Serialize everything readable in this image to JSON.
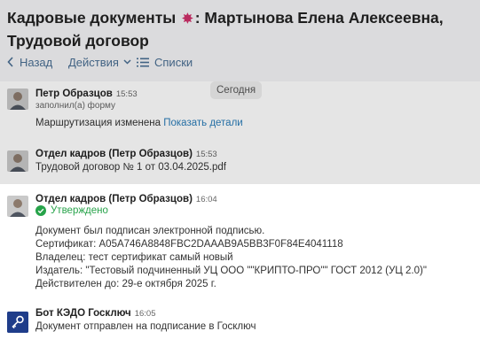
{
  "header": {
    "title_part1": "Кадровые документы",
    "title_part2": ": Мартынова Елена Алексеевна, Трудовой договор"
  },
  "toolbar": {
    "back_label": "Назад",
    "actions_label": "Действия",
    "lists_label": "Списки"
  },
  "feed": {
    "date_badge": "Сегодня",
    "messages": [
      {
        "sender": "Петр Образцов",
        "time": "15:53",
        "subline": "заполнил(а) форму",
        "text": "Маршрутизация изменена",
        "link": "Показать детали"
      },
      {
        "sender": "Отдел кадров (Петр Образцов)",
        "time": "15:53",
        "text": "Трудовой договор № 1 от 03.04.2025.pdf"
      },
      {
        "sender": "Отдел кадров (Петр Образцов)",
        "time": "16:04",
        "status": "Утверждено",
        "lines": [
          "Документ был подписан электронной подписью.",
          "Сертификат: A05A746A8848FBC2DAAAB9A5BB3F0F84E4041118",
          "Владелец: тест сертификат самый новый",
          "Издатель: \"Тестовый подчиненный УЦ ООО \"\"КРИПТО-ПРО\"\" ГОСТ 2012 (УЦ 2.0)\"",
          "Действителен до: 29-е октября 2025 г."
        ]
      },
      {
        "sender": "Бот КЭДО Госключ",
        "time": "16:05",
        "text": "Документ отправлен на подписание в Госключ"
      }
    ]
  },
  "colors": {
    "link": "#2a7cb8",
    "toolbar": "#4a6f93",
    "approved": "#27a34a",
    "bot_avatar": "#1f3d8a"
  }
}
